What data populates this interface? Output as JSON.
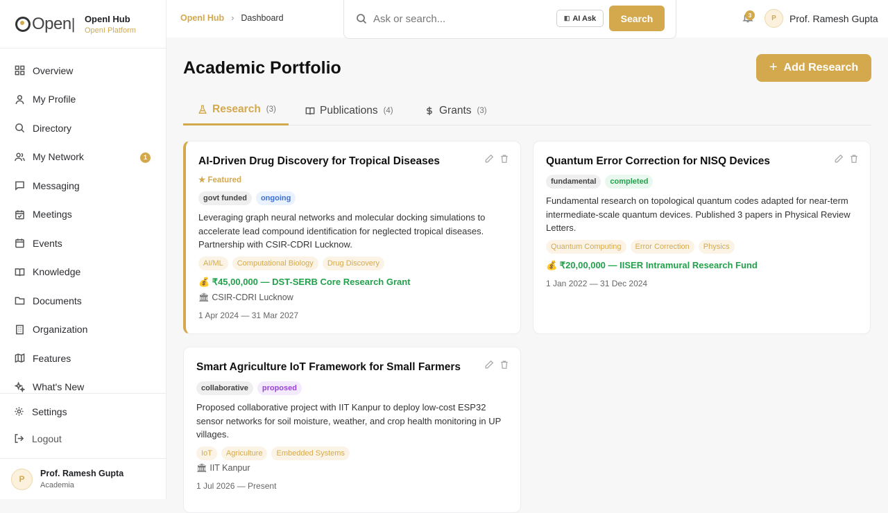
{
  "brand": {
    "logo_text": "Open",
    "name": "OpenI Hub",
    "sub": "OpenI Platform"
  },
  "sidebar": {
    "items": [
      {
        "label": "Overview",
        "icon": "grid-icon"
      },
      {
        "label": "My Profile",
        "icon": "user-icon"
      },
      {
        "label": "Directory",
        "icon": "search-icon"
      },
      {
        "label": "My Network",
        "icon": "users-icon",
        "badge": "1"
      },
      {
        "label": "Messaging",
        "icon": "message-icon"
      },
      {
        "label": "Meetings",
        "icon": "calendar-check-icon"
      },
      {
        "label": "Events",
        "icon": "calendar-icon"
      },
      {
        "label": "Knowledge",
        "icon": "book-icon"
      },
      {
        "label": "Documents",
        "icon": "folder-icon"
      },
      {
        "label": "Organization",
        "icon": "building-icon"
      },
      {
        "label": "Features",
        "icon": "map-icon"
      },
      {
        "label": "What's New",
        "icon": "sparkle-icon"
      }
    ],
    "settings": "Settings",
    "logout": "Logout",
    "user": {
      "initial": "P",
      "name": "Prof. Ramesh Gupta",
      "role": "Academia"
    }
  },
  "topbar": {
    "breadcrumb": [
      "OpenI Hub",
      "Dashboard"
    ],
    "search_placeholder": "Ask or search...",
    "ai_ask": "AI Ask",
    "search_button": "Search",
    "notifications": "3",
    "user_initial": "P",
    "user_name": "Prof. Ramesh Gupta"
  },
  "main": {
    "title": "Academic Portfolio",
    "add_button": "Add Research",
    "tabs": [
      {
        "label": "Research",
        "count": "(3)",
        "icon": "flask-icon"
      },
      {
        "label": "Publications",
        "count": "(4)",
        "icon": "book-open-icon"
      },
      {
        "label": "Grants",
        "count": "(3)",
        "icon": "dollar-icon"
      }
    ]
  },
  "cards": [
    {
      "title": "AI-Driven Drug Discovery for Tropical Diseases",
      "featured": "★ Featured",
      "status_chips": [
        "govt funded",
        "ongoing"
      ],
      "desc": "Leveraging graph neural networks and molecular docking simulations to accelerate lead compound identification for neglected tropical diseases. Partnership with CSIR-CDRI Lucknow.",
      "tags": [
        "AI/ML",
        "Computational Biology",
        "Drug Discovery"
      ],
      "funding": "💰 ₹45,00,000 — DST-SERB Core Research Grant",
      "institution": "🏛 CSIR-CDRI Lucknow",
      "dates": "1 Apr 2024 — 31 Mar 2027"
    },
    {
      "title": "Quantum Error Correction for NISQ Devices",
      "status_chips": [
        "fundamental",
        "completed"
      ],
      "desc": "Fundamental research on topological quantum codes adapted for near-term intermediate-scale quantum devices. Published 3 papers in Physical Review Letters.",
      "tags": [
        "Quantum Computing",
        "Error Correction",
        "Physics"
      ],
      "funding": "💰 ₹20,00,000 — IISER Intramural Research Fund",
      "dates": "1 Jan 2022 — 31 Dec 2024"
    },
    {
      "title": "Smart Agriculture IoT Framework for Small Farmers",
      "status_chips": [
        "collaborative",
        "proposed"
      ],
      "desc": "Proposed collaborative project with IIT Kanpur to deploy low-cost ESP32 sensor networks for soil moisture, weather, and crop health monitoring in UP villages.",
      "tags": [
        "IoT",
        "Agriculture",
        "Embedded Systems"
      ],
      "institution": "🏛 IIT Kanpur",
      "dates": "1 Jul 2026 — Present"
    }
  ],
  "colors": {
    "accent": "#d4a94e",
    "funding": "#22a04b"
  }
}
